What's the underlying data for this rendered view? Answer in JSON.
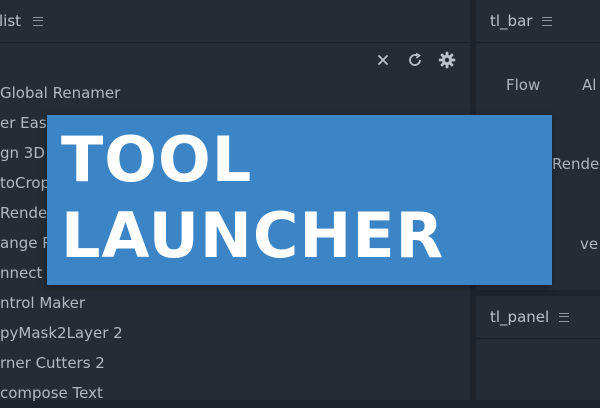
{
  "left_panel": {
    "title": "list",
    "tools": [
      "Global Renamer",
      "er Eas",
      "gn 3D",
      "toCrop",
      "Rende",
      "ange R",
      "nnect",
      "ntrol Maker",
      "pyMask2Layer 2",
      "rner Cutters 2",
      "compose Text"
    ]
  },
  "right_top_panel": {
    "title": "tl_bar",
    "items": [
      "Flow",
      "Al",
      "Rende",
      "ve"
    ]
  },
  "right_bottom_panel": {
    "title": "tl_panel"
  },
  "banner": {
    "line1": "TOOL",
    "line2": "LAUNCHER"
  },
  "icons": {
    "close": "close-icon",
    "refresh": "refresh-icon",
    "settings": "gear-icon",
    "menu": "hamburger-icon"
  },
  "colors": {
    "background": "#1f242c",
    "panel": "#262c35",
    "banner": "#3b85c7",
    "banner_text": "#ffffff"
  }
}
